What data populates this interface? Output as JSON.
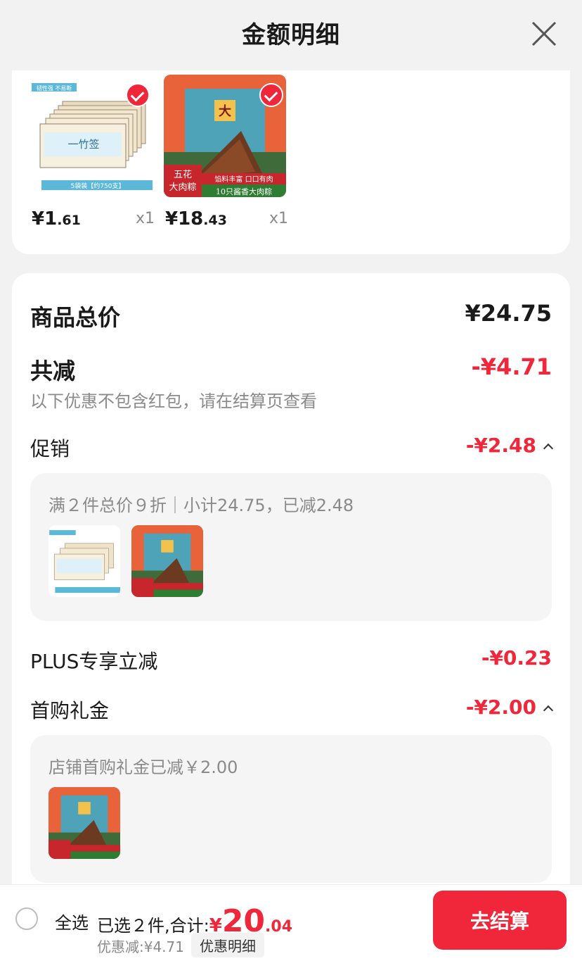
{
  "header": {
    "title": "金额明细"
  },
  "products": [
    {
      "price_int": "¥1",
      "price_dec": ".61",
      "qty": "x1",
      "badge": "韧性强 不易断",
      "brand": "一竹签",
      "caption": "5袋装【约750支】"
    },
    {
      "price_int": "¥18",
      "price_dec": ".43",
      "qty": "x1",
      "char": "大",
      "tag1": "五花",
      "tag2": "大肉粽",
      "tag3": "馅料丰富 口口有肉",
      "tag4": "10只酱香大肉粽"
    }
  ],
  "summary": {
    "total_label": "商品总价",
    "total_value": "¥24.75",
    "reduce_label": "共减",
    "reduce_value": "-¥4.71",
    "note": "以下优惠不包含红包，请在结算页查看",
    "promo_label": "促销",
    "promo_value": "-¥2.48",
    "promo_desc": "满２件总价９折｜小计24.75，已减2.48",
    "plus_label": "PLUS专享立减",
    "plus_value": "-¥0.23",
    "gift_label": "首购礼金",
    "gift_value": "-¥2.00",
    "gift_desc": "店铺首购礼金已减￥2.00"
  },
  "bottom": {
    "select_all": "全选",
    "selected_text": "已选２件,合计:",
    "total_yen": "¥",
    "total_int": "20",
    "total_dec": ".04",
    "saved": "优惠减:¥4.71",
    "detail_button": "优惠明细",
    "checkout": "去结算"
  },
  "colors": {
    "accent": "#f0263a",
    "background": "#f2f2f2"
  }
}
